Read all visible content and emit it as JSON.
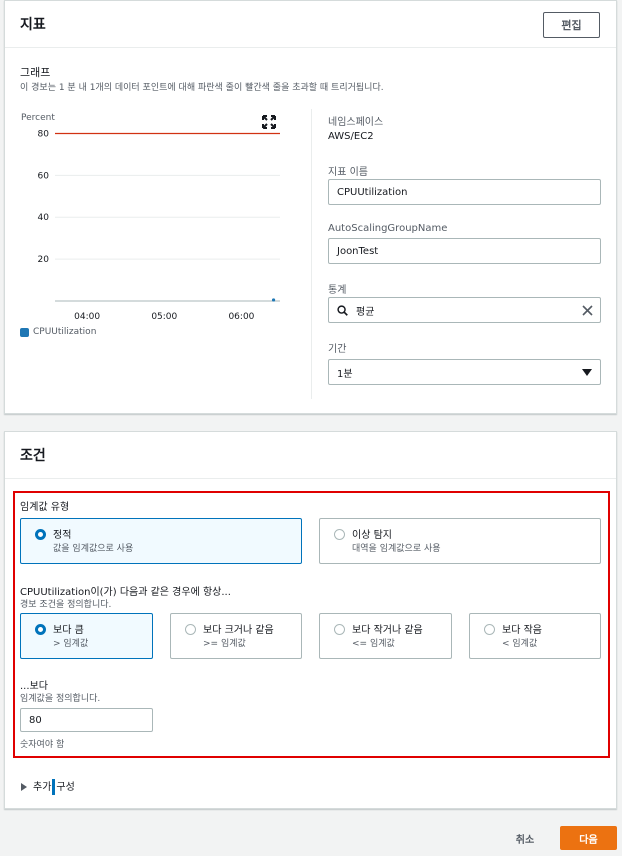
{
  "metric_panel": {
    "title": "지표",
    "edit_label": "편집",
    "graph": {
      "title": "그래프",
      "description": "이 경보는 1 분 내 1개의 데이터 포인트에 대해 파란색 줄이 빨간색 줄을 초과할 때 트리거됩니다.",
      "unit": "Percent",
      "legend": "CPUUtilization"
    },
    "namespace_label": "네임스페이스",
    "namespace_value": "AWS/EC2",
    "metric_name_label": "지표 이름",
    "metric_name_value": "CPUUtilization",
    "dimension_label": "AutoScalingGroupName",
    "dimension_value": "JoonTest",
    "statistic_label": "통계",
    "statistic_value": "평균",
    "period_label": "기간",
    "period_value": "1분"
  },
  "chart_data": {
    "type": "line",
    "yticks": [
      20,
      40,
      60,
      80
    ],
    "xticks": [
      "04:00",
      "05:00",
      "06:00"
    ],
    "ylim": [
      0,
      85
    ],
    "threshold": 80,
    "threshold_color": "#d13212",
    "series": [
      {
        "name": "CPUUtilization",
        "color": "#1f77b4",
        "points": [
          {
            "x": "06:25",
            "y": 0.5
          }
        ]
      }
    ]
  },
  "conditions_panel": {
    "title": "조건",
    "threshold_type_label": "임계값 유형",
    "threshold_types": [
      {
        "title": "정적",
        "subtitle": "값을 임계값으로 사용",
        "selected": true
      },
      {
        "title": "이상 탐지",
        "subtitle": "대역을 임계값으로 사용",
        "selected": false
      }
    ],
    "condition_label": "CPUUtilization이(가) 다음과 같은 경우에 항상...",
    "condition_desc": "경보 조건을 정의합니다.",
    "operators": [
      {
        "title": "보다 큼",
        "subtitle": "> 임계값",
        "selected": true
      },
      {
        "title": "보다 크거나 같음",
        "subtitle": ">= 임계값",
        "selected": false
      },
      {
        "title": "보다 작거나 같음",
        "subtitle": "<= 임계값",
        "selected": false
      },
      {
        "title": "보다 작음",
        "subtitle": "< 임계값",
        "selected": false
      }
    ],
    "than_label": "...보다",
    "than_desc": "임계값을 정의합니다.",
    "threshold_value": "80",
    "threshold_hint": "숫자여야 함",
    "extra_config_part1": "추가",
    "extra_config_part2": "구성"
  },
  "footer": {
    "cancel_label": "취소",
    "next_label": "다음",
    "next_color": "#ec7211"
  },
  "colors": {
    "selection": "#0073bb",
    "highlight_box": "#e00000"
  }
}
